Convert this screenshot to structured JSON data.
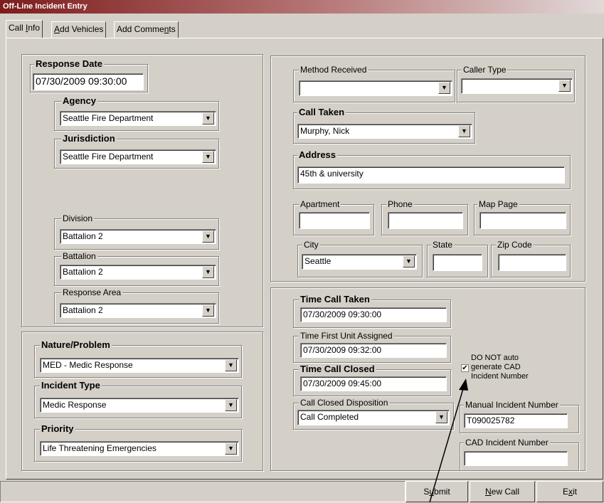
{
  "window": {
    "title": "Off-Line Incident Entry"
  },
  "tabs": [
    {
      "pre": "Call ",
      "key": "I",
      "post": "nfo"
    },
    {
      "pre": "",
      "key": "A",
      "post": "dd Vehicles"
    },
    {
      "pre": "Add Comme",
      "key": "n",
      "post": "ts"
    }
  ],
  "left": {
    "response_date": {
      "label": "Response Date",
      "value": "07/30/2009 09:30:00"
    },
    "agency": {
      "label": "Agency",
      "value": "Seattle Fire Department"
    },
    "jurisdiction": {
      "label": "Jurisdiction",
      "value": "Seattle Fire Department"
    },
    "division": {
      "label": "Division",
      "value": "Battalion 2"
    },
    "battalion": {
      "label": "Battalion",
      "value": "Battalion 2"
    },
    "response_area": {
      "label": "Response Area",
      "value": "Battalion 2"
    },
    "nature_problem": {
      "label": "Nature/Problem",
      "value": "MED - Medic Response"
    },
    "incident_type": {
      "label": "Incident Type",
      "value": "Medic Response"
    },
    "priority": {
      "label": "Priority",
      "value": "Life Threatening Emergencies"
    }
  },
  "right_top": {
    "method_received": {
      "label": "Method Received",
      "value": ""
    },
    "caller_type": {
      "label": "Caller Type",
      "value": ""
    },
    "call_taken": {
      "label": "Call Taken",
      "value": "Murphy, Nick"
    },
    "address": {
      "label": "Address",
      "value": "45th & university"
    },
    "apartment": {
      "label": "Apartment",
      "value": ""
    },
    "phone": {
      "label": "Phone",
      "value": ""
    },
    "map_page": {
      "label": "Map Page",
      "value": ""
    },
    "city": {
      "label": "City",
      "value": "Seattle"
    },
    "state": {
      "label": "State",
      "value": ""
    },
    "zip_code": {
      "label": "Zip Code",
      "value": ""
    }
  },
  "right_bottom": {
    "time_call_taken": {
      "label": "Time Call Taken",
      "value": "07/30/2009 09:30:00"
    },
    "time_first_unit": {
      "label": "Time First Unit Assigned",
      "value": "07/30/2009 09:32:00"
    },
    "time_call_closed": {
      "label": "Time Call Closed",
      "value": "07/30/2009 09:45:00"
    },
    "call_closed_disposition": {
      "label": "Call Closed Disposition",
      "value": "Call Completed"
    },
    "do_not_auto": {
      "line1": "DO NOT auto",
      "line2": "generate CAD",
      "line3": "Incident Number",
      "checked": true,
      "mark": "✔"
    },
    "manual_incident_number": {
      "label": "Manual Incident Number",
      "value": "T090025782"
    },
    "cad_incident_number": {
      "label": "CAD Incident Number",
      "value": ""
    }
  },
  "buttons": [
    {
      "pre": "S",
      "key": "u",
      "post": "bmit"
    },
    {
      "pre": "",
      "key": "N",
      "post": "ew Call"
    },
    {
      "pre": "E",
      "key": "x",
      "post": "it"
    }
  ],
  "icons": {
    "dropdown": "▼"
  }
}
